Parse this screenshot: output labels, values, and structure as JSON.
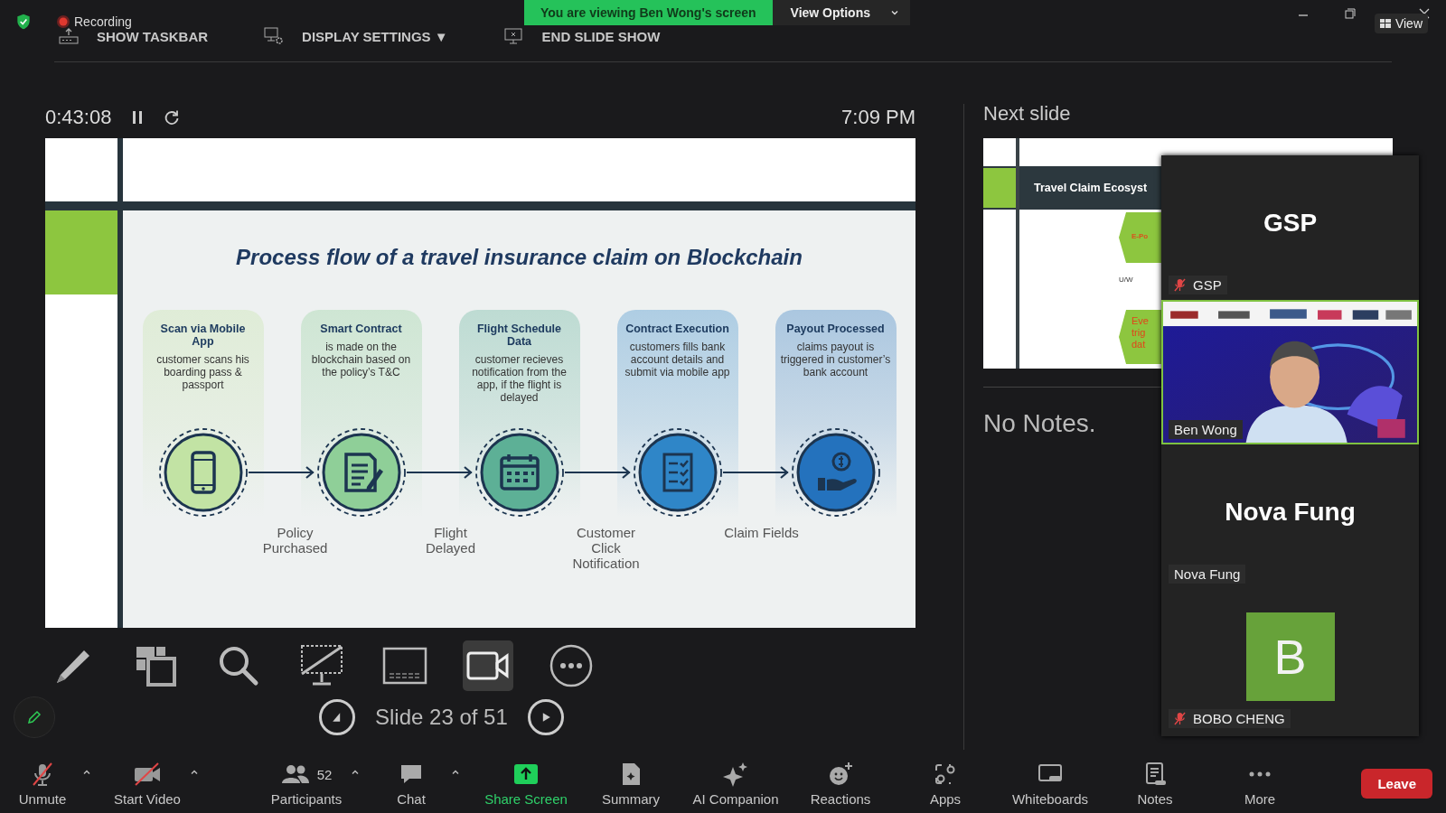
{
  "meeting": {
    "recording": "Recording",
    "banner": "You are viewing Ben Wong's screen",
    "view_options": "View Options",
    "view_button": "View"
  },
  "presenter_toolbar": [
    {
      "label": "SHOW TASKBAR",
      "kind": "taskbar"
    },
    {
      "label": "DISPLAY SETTINGS ▼",
      "kind": "display"
    },
    {
      "label": "END SLIDE SHOW",
      "kind": "end"
    }
  ],
  "timer": {
    "elapsed": "0:43:08",
    "clock": "7:09 PM"
  },
  "slide": {
    "title": "Process flow of a travel insurance claim on Blockchain",
    "steps": [
      {
        "title": "Scan via Mobile App",
        "text": "customer scans his boarding pass & passport",
        "kind": "phone",
        "color": "#c2e3a4"
      },
      {
        "title": "Smart Contract",
        "text": "is made on the blockchain based on the policy’s T&C",
        "kind": "document",
        "color": "#8fcf98"
      },
      {
        "title": "Flight Schedule Data",
        "text": "customer recieves notification from the app, if the flight is delayed",
        "kind": "calendar",
        "color": "#5db096"
      },
      {
        "title": "Contract Execution",
        "text": "customers fills bank account details and submit via mobile app",
        "kind": "checklist",
        "color": "#2f86c8"
      },
      {
        "title": "Payout Processed",
        "text": "claims payout is triggered in customer’s bank account",
        "kind": "payout",
        "color": "#2472bd"
      }
    ],
    "connectors": [
      "Policy Purchased",
      "Flight Delayed",
      "Customer Click Notification",
      "Claim Fields"
    ]
  },
  "tools": [
    {
      "kind": "pen",
      "selected": false
    },
    {
      "kind": "layout",
      "selected": false
    },
    {
      "kind": "search",
      "selected": false
    },
    {
      "kind": "no-screen",
      "selected": false
    },
    {
      "kind": "subtitles",
      "selected": false
    },
    {
      "kind": "camera",
      "selected": true
    },
    {
      "kind": "more",
      "selected": false
    }
  ],
  "slide_nav": {
    "label": "Slide 23 of 51"
  },
  "side": {
    "next_heading": "Next slide",
    "next_title": "Travel Claim Ecosyst",
    "next_hex_top": "E-Po",
    "next_mid": "U/W",
    "next_hex_bottom": [
      "Eve",
      "trig",
      "dat"
    ],
    "notes": "No Notes."
  },
  "participants": [
    {
      "name": "GSP",
      "kind": "name",
      "display": "GSP",
      "muted": true,
      "speaking": false
    },
    {
      "name": "Ben Wong",
      "kind": "video",
      "muted": false,
      "speaking": true
    },
    {
      "name": "Nova Fung",
      "kind": "name",
      "display": "Nova Fung",
      "muted": false,
      "speaking": false
    },
    {
      "name": "BOBO CHENG",
      "kind": "avatar",
      "initial": "B",
      "muted": true,
      "speaking": false
    }
  ],
  "toolbar": [
    {
      "label": "Unmute",
      "kind": "mic-off",
      "caret": true
    },
    {
      "label": "Start Video",
      "kind": "video-off",
      "caret": true
    },
    {
      "label": "Participants",
      "kind": "people",
      "count": "52",
      "caret": true
    },
    {
      "label": "Chat",
      "kind": "chat",
      "caret": true
    },
    {
      "label": "Share Screen",
      "kind": "share",
      "caret": false
    },
    {
      "label": "Summary",
      "kind": "summary",
      "caret": false
    },
    {
      "label": "AI Companion",
      "kind": "sparkle",
      "caret": false
    },
    {
      "label": "Reactions",
      "kind": "reactions",
      "caret": false
    },
    {
      "label": "Apps",
      "kind": "apps",
      "caret": false
    },
    {
      "label": "Whiteboards",
      "kind": "whiteboard",
      "caret": false
    },
    {
      "label": "Notes",
      "kind": "notes",
      "caret": false
    },
    {
      "label": "More",
      "kind": "more",
      "caret": false
    }
  ],
  "leave": "Leave"
}
